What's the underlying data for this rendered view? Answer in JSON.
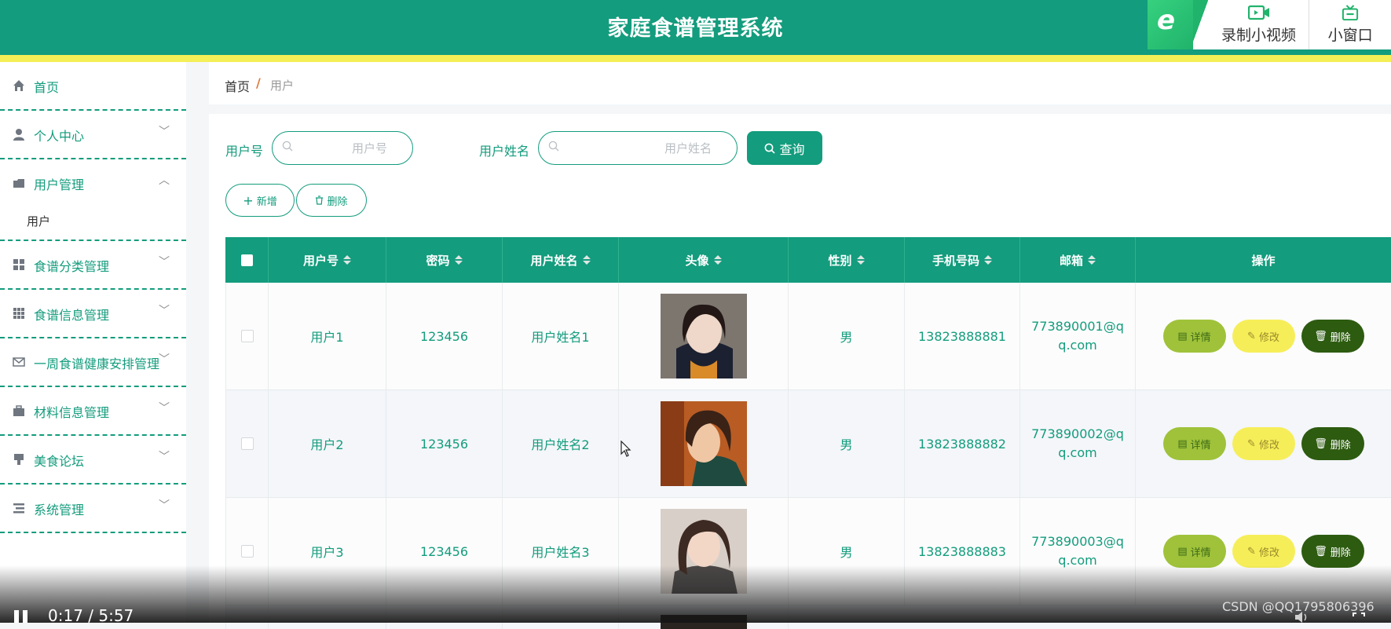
{
  "header": {
    "title": "家庭食谱管理系统",
    "overlay_buttons": [
      {
        "label": "录制小视频",
        "icon": "video-record-icon"
      },
      {
        "label": "小窗口",
        "icon": "tv-window-icon"
      }
    ]
  },
  "sidebar": {
    "items": [
      {
        "label": "首页",
        "icon": "home-icon"
      },
      {
        "label": "个人中心",
        "icon": "user-icon"
      },
      {
        "label": "用户管理",
        "icon": "folder-icon",
        "expanded": true
      },
      {
        "label": "用户",
        "sub": true
      },
      {
        "label": "食谱分类管理",
        "icon": "grid-icon"
      },
      {
        "label": "食谱信息管理",
        "icon": "apps-icon"
      },
      {
        "label": "一周食谱健康安排管理",
        "icon": "mail-icon"
      },
      {
        "label": "材料信息管理",
        "icon": "briefcase-icon"
      },
      {
        "label": "美食论坛",
        "icon": "forum-icon"
      },
      {
        "label": "系统管理",
        "icon": "list-icon"
      }
    ]
  },
  "breadcrumb": {
    "home": "首页",
    "separator": "/",
    "current": "用户"
  },
  "search": {
    "user_id_label": "用户号",
    "user_id_placeholder": "用户号",
    "user_name_label": "用户姓名",
    "user_name_placeholder": "用户姓名",
    "query_button": "查询"
  },
  "actions": {
    "add": "新增",
    "delete": "删除"
  },
  "table": {
    "columns": [
      "用户号",
      "密码",
      "用户姓名",
      "头像",
      "性别",
      "手机号码",
      "邮箱",
      "操作"
    ],
    "row_actions": {
      "detail": "详情",
      "edit": "修改",
      "delete": "删除"
    },
    "rows": [
      {
        "user_id": "用户1",
        "password": "123456",
        "name": "用户姓名1",
        "gender": "男",
        "phone": "13823888881",
        "email": "773890001@qq.com"
      },
      {
        "user_id": "用户2",
        "password": "123456",
        "name": "用户姓名2",
        "gender": "男",
        "phone": "13823888882",
        "email": "773890002@qq.com"
      },
      {
        "user_id": "用户3",
        "password": "123456",
        "name": "用户姓名3",
        "gender": "男",
        "phone": "13823888883",
        "email": "773890003@qq.com"
      }
    ]
  },
  "video": {
    "time": "0:17 / 5:57",
    "watermark": "CSDN @QQ1795806396"
  },
  "colors": {
    "primary": "#139c7d",
    "stripe": "#f4ee57",
    "detail": "#9fc23a",
    "edit": "#f6ee59",
    "delete": "#2d5b10"
  }
}
